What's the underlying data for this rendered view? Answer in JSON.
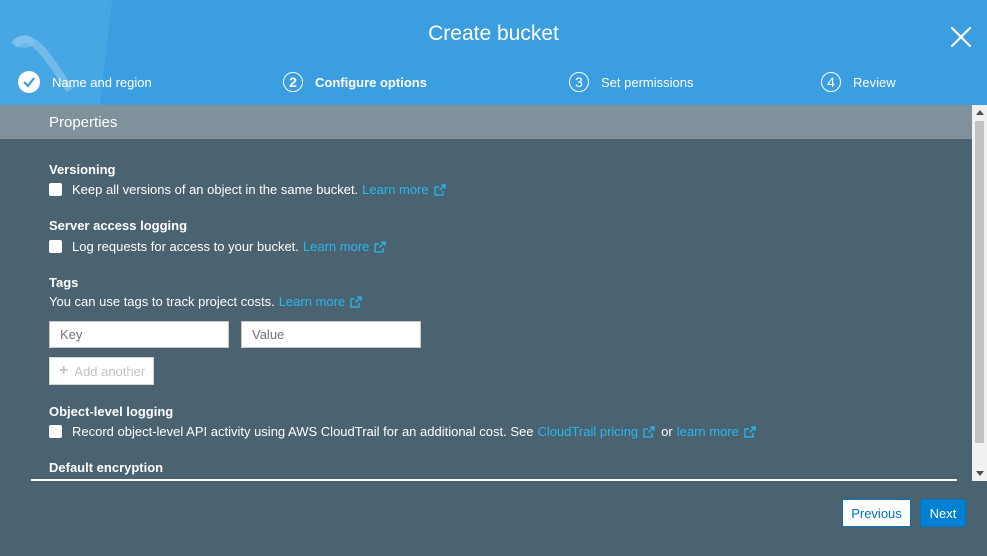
{
  "dialog": {
    "title": "Create bucket"
  },
  "steps": [
    {
      "number": "",
      "label": "Name and region",
      "state": "completed"
    },
    {
      "number": "2",
      "label": "Configure options",
      "state": "active"
    },
    {
      "number": "3",
      "label": "Set permissions",
      "state": "upcoming"
    },
    {
      "number": "4",
      "label": "Review",
      "state": "upcoming"
    }
  ],
  "properties": {
    "heading": "Properties"
  },
  "versioning": {
    "title": "Versioning",
    "text": "Keep all versions of an object in the same bucket.",
    "link": "Learn more",
    "checked": false
  },
  "logging": {
    "title": "Server access logging",
    "text": "Log requests for access to your bucket.",
    "link": "Learn more",
    "checked": false
  },
  "tags": {
    "title": "Tags",
    "text": "You can use tags to track project costs.",
    "link": "Learn more",
    "key_placeholder": "Key",
    "value_placeholder": "Value",
    "add_label": "Add another"
  },
  "object_logging": {
    "title": "Object-level logging",
    "text": "Record object-level API activity using AWS CloudTrail for an additional cost. See",
    "link1": "CloudTrail pricing",
    "or": "or",
    "link2": "learn more",
    "checked": false
  },
  "encryption": {
    "title": "Default encryption"
  },
  "footer": {
    "previous_label": "Previous",
    "next_label": "Next"
  },
  "colors": {
    "header": "#3a9ee0",
    "body": "#4b6271",
    "properties_bar": "#7f919b",
    "link": "#29b7f0",
    "primary_button": "#0080d2"
  },
  "icons": [
    "check-circle-icon",
    "close-icon",
    "external-link-icon",
    "plus-icon"
  ]
}
